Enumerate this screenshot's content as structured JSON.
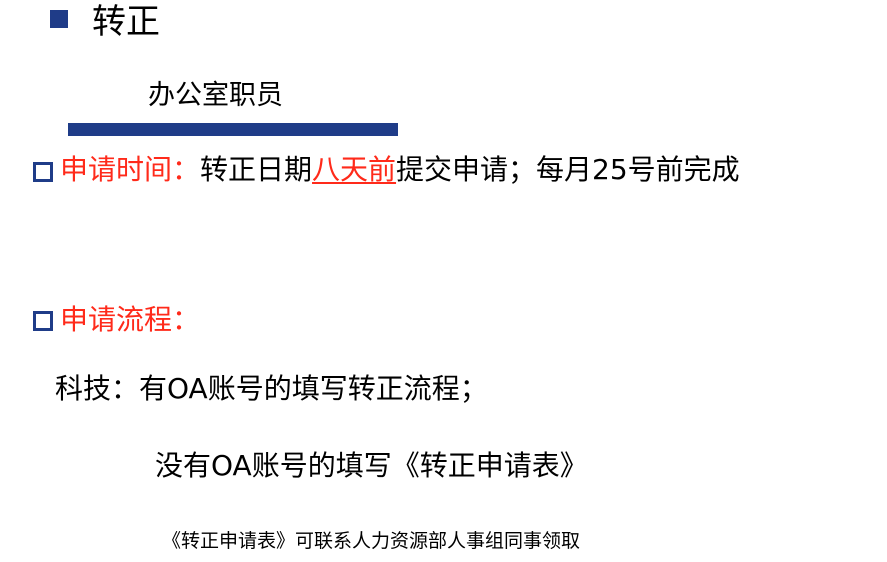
{
  "heading": {
    "title": "转正",
    "subtitle": "办公室职员"
  },
  "application_time": {
    "label": "申请时间：",
    "text_before": "转正日期",
    "emphasis": "八天前",
    "text_after": "提交申请；每月25号前完成"
  },
  "process": {
    "label": "申请流程：",
    "line1": "科技：有OA账号的填写转正流程；",
    "line2": "没有OA账号的填写《转正申请表》"
  },
  "note": "《转正申请表》可联系人力资源部人事组同事领取",
  "colors": {
    "accent_blue": "#1f3c88",
    "highlight_red": "#ff2a1a"
  }
}
